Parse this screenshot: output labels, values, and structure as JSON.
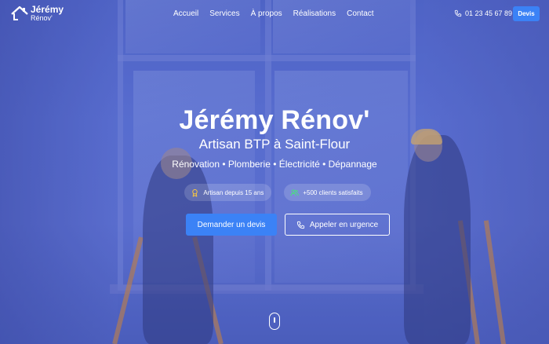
{
  "brand": {
    "name": "Jérémy",
    "sub": "Rénov'",
    "icon": "house-roof-icon"
  },
  "nav": [
    {
      "label": "Accueil"
    },
    {
      "label": "Services"
    },
    {
      "label": "À propos"
    },
    {
      "label": "Réalisations"
    },
    {
      "label": "Contact"
    }
  ],
  "header": {
    "phone": "01 23 45 67 89",
    "phone_icon": "phone-icon",
    "cta": "Devis"
  },
  "hero": {
    "title": "Jérémy Rénov'",
    "subtitle": "Artisan BTP à Saint-Flour",
    "services": "Rénovation • Plomberie • Électricité • Dépannage",
    "badges": [
      {
        "label": "Artisan depuis 15 ans",
        "icon": "medal-icon"
      },
      {
        "label": "+500 clients satisfaits",
        "icon": "users-icon"
      }
    ],
    "primary_cta": "Demander un devis",
    "secondary_cta": "Appeler en urgence",
    "secondary_icon": "phone-icon",
    "scroll_icon": "mouse-scroll-icon"
  },
  "colors": {
    "accent": "#3b82f6",
    "overlay": "#5a6fd0",
    "badge_icon_gold": "#f5c542",
    "badge_icon_green": "#4ade80"
  }
}
